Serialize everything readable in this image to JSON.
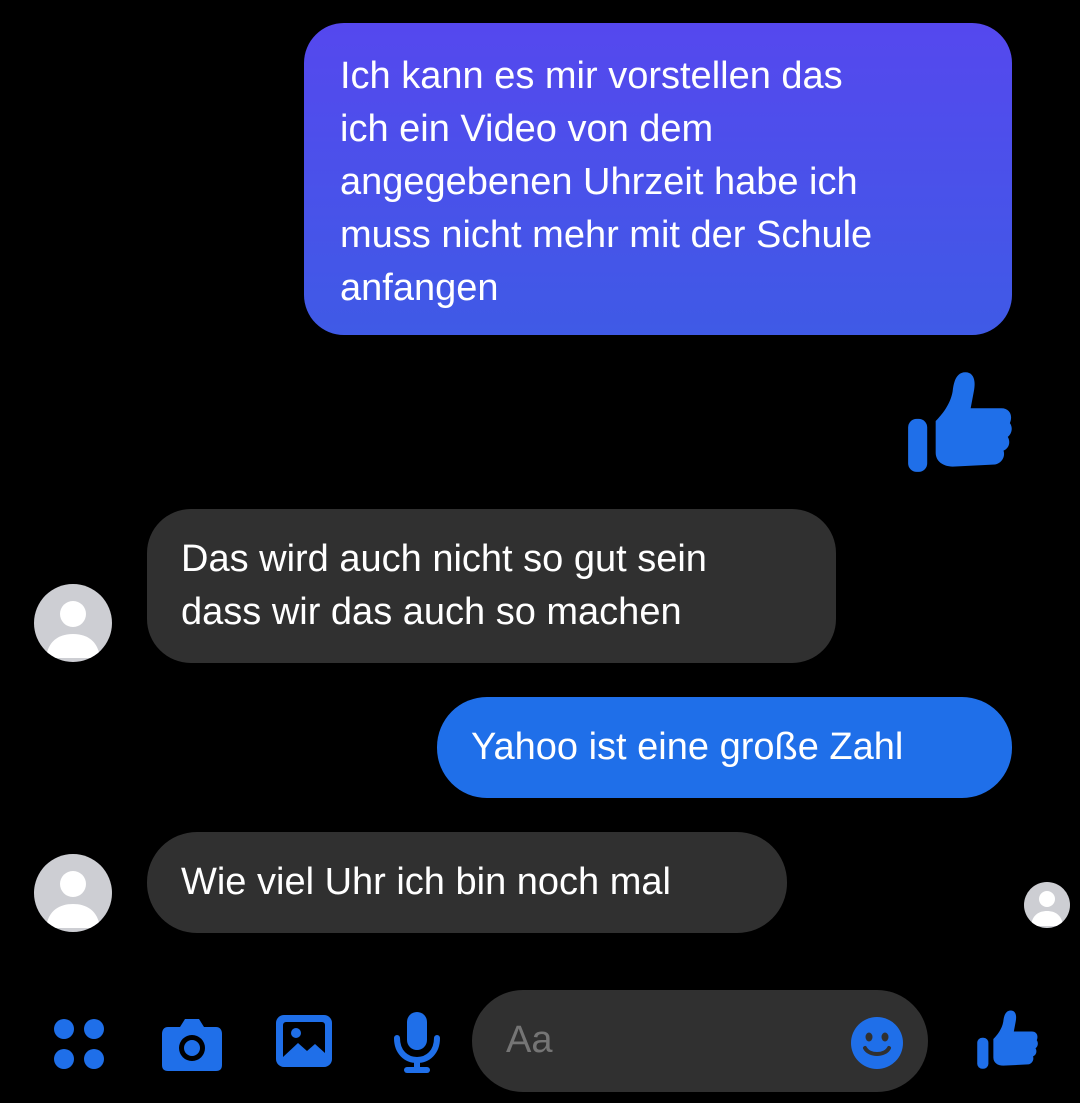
{
  "colors": {
    "background": "#000000",
    "sent_gradient_top": "#5548ee",
    "sent_gradient_bottom": "#3f5ae6",
    "sent_blue": "#1f6fe9",
    "received": "#303030",
    "accent": "#1f6fe9",
    "avatar": "#cdced3"
  },
  "messages": [
    {
      "from": "me",
      "text": "Ich kann es mir vorstellen das\nich ein Video von dem\nangegebenen Uhrzeit habe ich\nmuss nicht mehr mit der Schule\nanfangen"
    },
    {
      "from": "me",
      "type": "like",
      "icon": "thumbs-up-icon"
    },
    {
      "from": "other",
      "text": "Das wird auch nicht so gut sein\ndass wir das auch so machen"
    },
    {
      "from": "me",
      "text": "Yahoo ist eine große Zahl"
    },
    {
      "from": "other",
      "text": "Wie viel Uhr ich bin noch mal"
    }
  ],
  "composer": {
    "placeholder": "Aa",
    "icons": [
      "apps-icon",
      "camera-icon",
      "gallery-icon",
      "microphone-icon",
      "emoji-icon",
      "thumbs-up-icon"
    ]
  }
}
